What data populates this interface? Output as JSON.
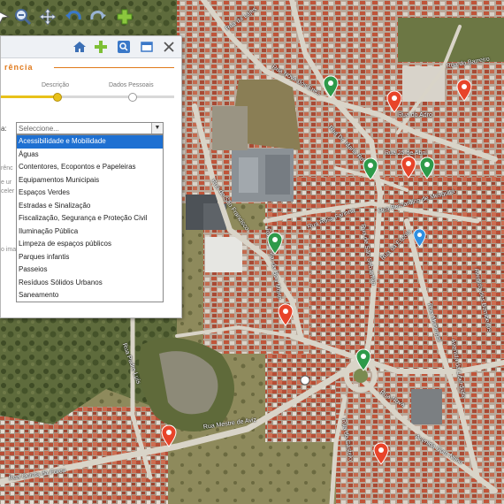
{
  "toolbar": {
    "icons": [
      "select-arrow-icon",
      "zoom-out-icon",
      "pan-icon",
      "undo-icon",
      "redo-icon",
      "add-icon"
    ]
  },
  "panel": {
    "title": "rência",
    "steps": {
      "current": "Descrição",
      "next": "Dados Pessoais"
    },
    "select_label": "a:",
    "select_placeholder": "Seleccione...",
    "options": [
      "Acessibilidade e Mobilidade",
      "Águas",
      "Contentores, Ecopontos e Papeleiras",
      "Equipamentos Municipais",
      "Espaços Verdes",
      "Estradas e Sinalização",
      "Fiscalização, Segurança e Proteção Civil",
      "Iluminação Pública",
      "Limpeza de espaços públicos",
      "Parques infantis",
      "Passeios",
      "Resíduos Sólidos Urbanos",
      "Saneamento"
    ],
    "side_fragments": [
      "rênc",
      "e ur",
      "celer",
      "o ima"
    ]
  },
  "map": {
    "roads": [
      "Rua da Lajes",
      "Rua do Barreiro",
      "Rua Nova dos Enes",
      "Rua do Adro",
      "Rua Dr. Maria Rosa",
      "Rua 25 de Abril",
      "Rua de São Francisco",
      "Rua Bernardino de Mesquita",
      "Rua Rosa Farinha",
      "Rua da Sra. da Boa Morte",
      "Rua de São Sebastião",
      "Avenida dos Bombeiros",
      "Rua da Escola",
      "Rua Municipal",
      "Avenida da Liberdade",
      "Rua Padre Luís",
      "Rua Mestre de Aviz",
      "Rua Nova",
      "Rua Quinta da Forca",
      "Avenida Dom Nuno",
      "Rua do Castelo"
    ]
  },
  "colors": {
    "marker_red": "#e8442a",
    "marker_green": "#2e9a4a",
    "marker_blue": "#2f8fe0",
    "accent_orange": "#e07a1c",
    "progress_yellow": "#e8c11a",
    "selected_option": "#1e70d2"
  }
}
